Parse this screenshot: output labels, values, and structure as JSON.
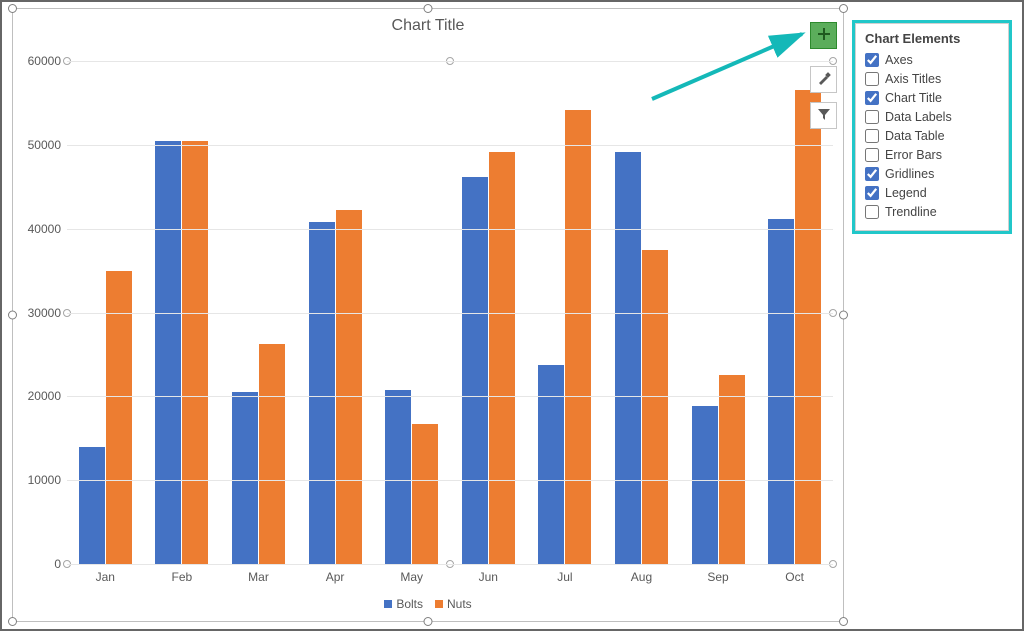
{
  "chart_data": {
    "type": "bar",
    "title": "Chart Title",
    "categories": [
      "Jan",
      "Feb",
      "Mar",
      "Apr",
      "May",
      "Jun",
      "Jul",
      "Aug",
      "Sep",
      "Oct"
    ],
    "series": [
      {
        "name": "Bolts",
        "color": "#4472c4",
        "values": [
          14000,
          50500,
          20500,
          40800,
          20800,
          46200,
          23700,
          49200,
          18800,
          41100
        ]
      },
      {
        "name": "Nuts",
        "color": "#ed7d31",
        "values": [
          35000,
          50500,
          26200,
          42200,
          16700,
          49200,
          54200,
          37500,
          22500,
          56500
        ]
      }
    ],
    "ylim": [
      0,
      60000
    ],
    "yticks": [
      0,
      10000,
      20000,
      30000,
      40000,
      50000,
      60000
    ],
    "xlabel": "",
    "ylabel": "",
    "grid": true,
    "legend_position": "bottom"
  },
  "flyout": {
    "plus_label": "Chart Elements",
    "brush_label": "Chart Styles",
    "filter_label": "Chart Filters"
  },
  "elements_panel": {
    "title": "Chart Elements",
    "items": [
      {
        "label": "Axes",
        "checked": true
      },
      {
        "label": "Axis Titles",
        "checked": false
      },
      {
        "label": "Chart Title",
        "checked": true
      },
      {
        "label": "Data Labels",
        "checked": false
      },
      {
        "label": "Data Table",
        "checked": false
      },
      {
        "label": "Error Bars",
        "checked": false
      },
      {
        "label": "Gridlines",
        "checked": true
      },
      {
        "label": "Legend",
        "checked": true
      },
      {
        "label": "Trendline",
        "checked": false
      }
    ]
  }
}
